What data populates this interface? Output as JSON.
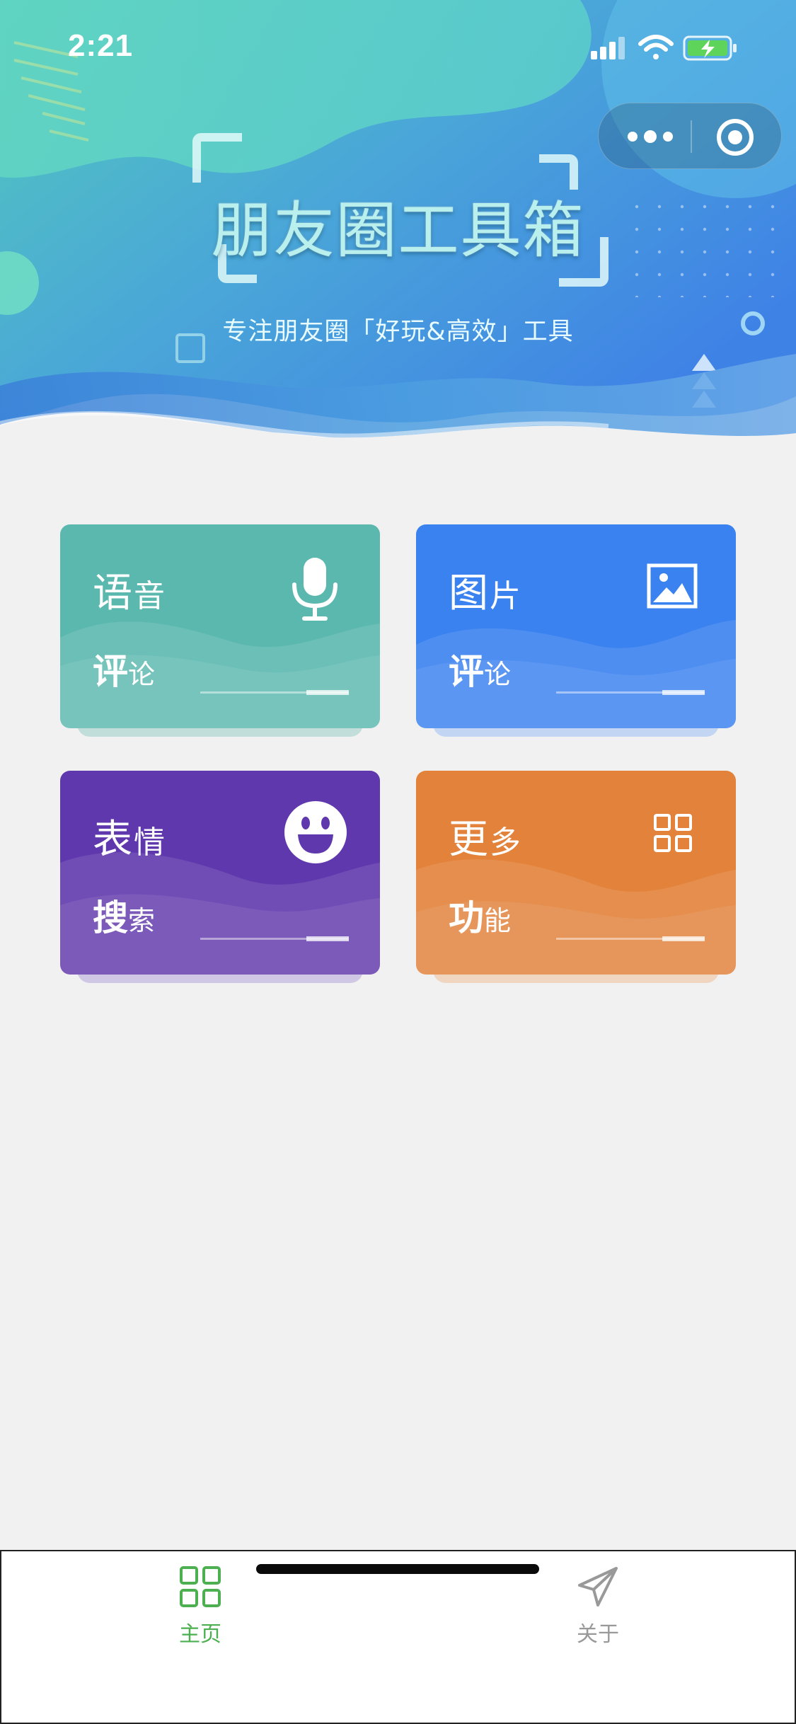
{
  "status_bar": {
    "time": "2:21"
  },
  "capsule": {
    "more_icon": "more-dots-icon",
    "close_icon": "target-close-icon"
  },
  "banner": {
    "title": "朋友圈工具箱",
    "subtitle": "专注朋友圈「好玩&高效」工具"
  },
  "cards": [
    {
      "title_big": "语",
      "title_small": "音",
      "sub_big": "评",
      "sub_small": "论",
      "icon": "microphone-icon",
      "color": "#5bb8af"
    },
    {
      "title_big": "图",
      "title_small": "片",
      "sub_big": "评",
      "sub_small": "论",
      "icon": "image-icon",
      "color": "#3a82f0"
    },
    {
      "title_big": "表",
      "title_small": "情",
      "sub_big": "搜",
      "sub_small": "索",
      "icon": "smiley-icon",
      "color": "#6038ad"
    },
    {
      "title_big": "更",
      "title_small": "多",
      "sub_big": "功",
      "sub_small": "能",
      "icon": "grid-icon",
      "color": "#e3823a"
    }
  ],
  "tabbar": {
    "home_label": "主页",
    "about_label": "关于",
    "active_color": "#4caf50",
    "inactive_color": "#999999"
  }
}
